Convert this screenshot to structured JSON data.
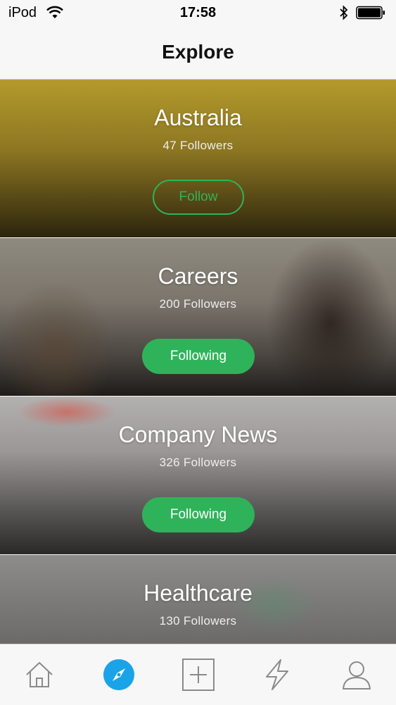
{
  "status_bar": {
    "carrier": "iPod",
    "time": "17:58"
  },
  "header": {
    "title": "Explore"
  },
  "cards": [
    {
      "title": "Australia",
      "followers": "47 Followers",
      "button": "Follow",
      "following": false
    },
    {
      "title": "Careers",
      "followers": "200 Followers",
      "button": "Following",
      "following": true
    },
    {
      "title": "Company News",
      "followers": "326 Followers",
      "button": "Following",
      "following": true
    },
    {
      "title": "Healthcare",
      "followers": "130 Followers"
    }
  ],
  "tab_bar": {
    "tabs": [
      {
        "icon": "home-icon"
      },
      {
        "icon": "compass-icon",
        "active": true
      },
      {
        "icon": "plus-square-icon"
      },
      {
        "icon": "lightning-icon"
      },
      {
        "icon": "profile-icon"
      }
    ]
  },
  "colors": {
    "accent_green": "#2fb35a",
    "active_tab_blue": "#1aa3e8",
    "icon_gray": "#8a8a8a"
  }
}
